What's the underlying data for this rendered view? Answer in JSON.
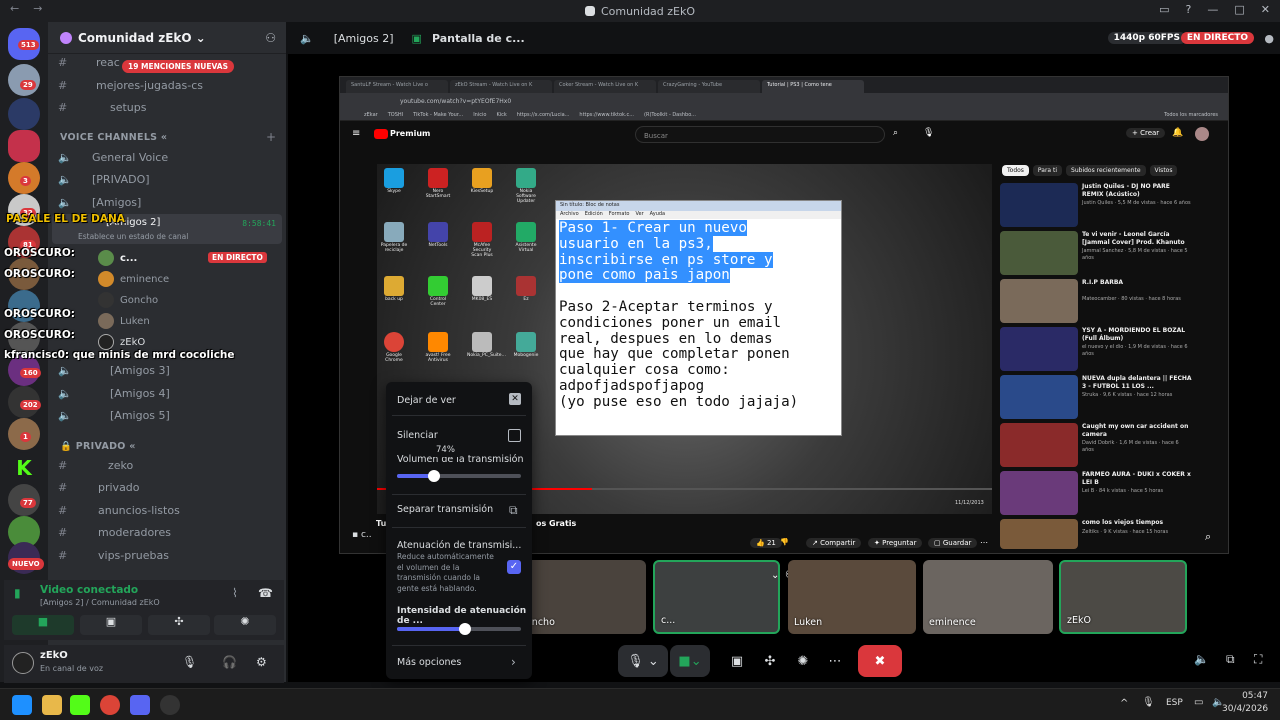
{
  "window": {
    "title": "Comunidad zEkO"
  },
  "server": {
    "name": "Comunidad zEkO",
    "mentions_banner": "19 MENCIONES NUEVAS",
    "badge_top": "513"
  },
  "rail_badges": [
    "29",
    "3",
    "32",
    "81",
    "160",
    "202",
    "1",
    "77"
  ],
  "rail_new": "NUEVO",
  "channels_top": [
    {
      "icon": "#",
      "label": "reac"
    },
    {
      "icon": "#",
      "label": "mejores-jugadas-cs"
    },
    {
      "icon": "#",
      "label": "setups"
    }
  ],
  "voice_category": "VOICE CHANNELS",
  "voice_channels": [
    {
      "label": "General Voice"
    },
    {
      "label": "[PRIVADO]"
    },
    {
      "label": "[Amigos]"
    },
    {
      "label": "[Amigos 2]"
    }
  ],
  "amigos2_time": "8:58:41",
  "status_line": "Establece un estado de canal",
  "voice_users": [
    {
      "name": "c...",
      "live": "EN DIRECTO"
    },
    {
      "name": "eminence"
    },
    {
      "name": "Goncho"
    },
    {
      "name": "Luken"
    },
    {
      "name": "zEkO"
    }
  ],
  "voice_channels2": [
    {
      "label": "[Amigos 3]"
    },
    {
      "label": "[Amigos 4]"
    },
    {
      "label": "[Amigos 5]"
    }
  ],
  "private_category": "PRIVADO",
  "private_channels": [
    {
      "label": "zeko"
    },
    {
      "label": "privado"
    },
    {
      "label": "anuncios-listos"
    },
    {
      "label": "moderadores"
    },
    {
      "label": "vips-pruebas"
    }
  ],
  "chat_overlay": [
    {
      "text": "PASALE EL DE DANA"
    },
    {
      "text": "OROSCURO:"
    },
    {
      "text": "OROSCURO:"
    },
    {
      "text": "OROSCURO:"
    },
    {
      "text": "OROSCURO:"
    },
    {
      "text": "kfrancisc0: que minis de mrd cocoliche"
    }
  ],
  "voice_connected": {
    "title": "Video conectado",
    "sub": "[Amigos 2] / Comunidad zEkO"
  },
  "me": {
    "name": "zEkO",
    "status": "En canal de voz"
  },
  "topbar": {
    "channel": "[Amigos 2]",
    "stream": "Pantalla de c...",
    "quality": "1440p 60FPS",
    "live": "EN DIRECTO"
  },
  "browser": {
    "tabs": [
      "SantuLF Stream - Watch Live o",
      "zEkO Stream - Watch Live on K",
      "Coker Stream - Watch Live on K",
      "CrazyGaming - YouTube",
      "Tutorial | PS3 | Como tene"
    ],
    "url": "youtube.com/watch?v=ptYEOfE7Hx0",
    "bookmarks": [
      "zEkar",
      "TOSHI",
      "TikTok - Make Your...",
      "Inicio",
      "Kick",
      "https://x.com/Lucia...",
      "https://www.tiktok.c...",
      "(R)Toolkit - Dashbo...",
      "Todos los marcadores"
    ],
    "search": "Buscar",
    "create": "Crear",
    "premium": "Premium",
    "chips": [
      "Todos",
      "Para ti",
      "Subidos recientemente",
      "Vistos"
    ]
  },
  "desktop_icons": [
    "Skype",
    "Nero StartSmart",
    "KiesSetup",
    "Nokia Software Updater",
    "Papelera de reciclaje",
    "NetTools",
    "McAfee Security Scan Plus",
    "Asistente Virtual",
    "back up",
    "Control Center",
    "MK08_ES",
    "Ez",
    "Google Chrome",
    "avast! Free Antivirus",
    "Nokia_PC_Suite...",
    "Mobogenie"
  ],
  "notepad": {
    "title": "Sin título: Bloc de notas",
    "menu": [
      "Archivo",
      "Edición",
      "Formato",
      "Ver",
      "Ayuda"
    ],
    "highlighted": [
      "Paso 1- Crear un nuevo",
      "usuario en la ps3,",
      "inscribirse en ps store y",
      "pone como pais japon"
    ],
    "body": [
      "",
      "Paso 2-Aceptar terminos y",
      "condiciones poner un email",
      "real, despues en lo demas",
      "que hay que completar ponen",
      "cualquier cosa como:",
      "adpofjadspofjapog",
      "(yo puse eso en todo jajaja)"
    ]
  },
  "video_under": {
    "title": "Tu",
    "title_tail": "os Gratis",
    "likes": "21",
    "share": "Compartir",
    "ask": "Preguntar",
    "save": "Guardar",
    "clock": "11/12/2013"
  },
  "recs": [
    {
      "title": "Justin Quiles - DJ NO PARE REMIX (Acústico)",
      "meta": "Justin Quiles · 5,5 M de vistas · hace 6 años",
      "dur": "2:16"
    },
    {
      "title": "Te vi venir - Leonel García [Jammal Cover] Prod. Khanuto",
      "meta": "Jammal Sanchez · 5,8 M de vistas · hace 5 años",
      "dur": "2:57"
    },
    {
      "title": "R.I.P BARBA",
      "meta": "Mateocamber · 80 vistas · hace 8 horas",
      "dur": "8:24"
    },
    {
      "title": "YSY A - MORDIENDO EL BOZAL (Full Álbum)",
      "meta": "el nuevo y el dio · 1,9 M de vistas · hace 6 años",
      "dur": "17:11"
    },
    {
      "title": "NUEVA dupla delantera || FECHA 3 - FUTBOL 11 LOS ...",
      "meta": "Struka · 9,6 K vistas · hace 12 horas",
      "dur": "1:08:20"
    },
    {
      "title": "Caught my own car accident on camera",
      "meta": "David Dobrik · 1,6 M de vistas · hace 6 años",
      "dur": "11:48"
    },
    {
      "title": "FARMEO AURA - DUKI x COKER x LEI B",
      "meta": "Lei B · 84 k vistas · hace 5 horas",
      "dur": "2:44"
    },
    {
      "title": "como los viejos tiempos",
      "meta": "Zeltiks · 9 K vistas · hace 15 horas",
      "dur": ""
    }
  ],
  "popup": {
    "stop": "Dejar de ver",
    "mute": "Silenciar",
    "volume_label": "Volumen de la transmisión",
    "volume_value": "74%",
    "volume": 0.74,
    "separate": "Separar transmisión",
    "atten_title": "Atenuación de transmisi...",
    "atten_desc": "Reduce automáticamente el volumen de la transmisión cuando la gente está hablando.",
    "atten_intensity": "Intensidad de atenuación de ...",
    "intensity": 0.55,
    "more": "Más opciones"
  },
  "tiles": [
    {
      "name": "oncho"
    },
    {
      "name": "c..."
    },
    {
      "name": "Luken"
    },
    {
      "name": "eminence"
    },
    {
      "name": "zEkO"
    }
  ],
  "chat_tail": "c..",
  "taskbar": {
    "lang": "ESP",
    "time": "05:47",
    "date": "30/4/2026"
  },
  "colors": {
    "accent": "#5865f2",
    "live": "#da373c",
    "green": "#23a55a"
  }
}
